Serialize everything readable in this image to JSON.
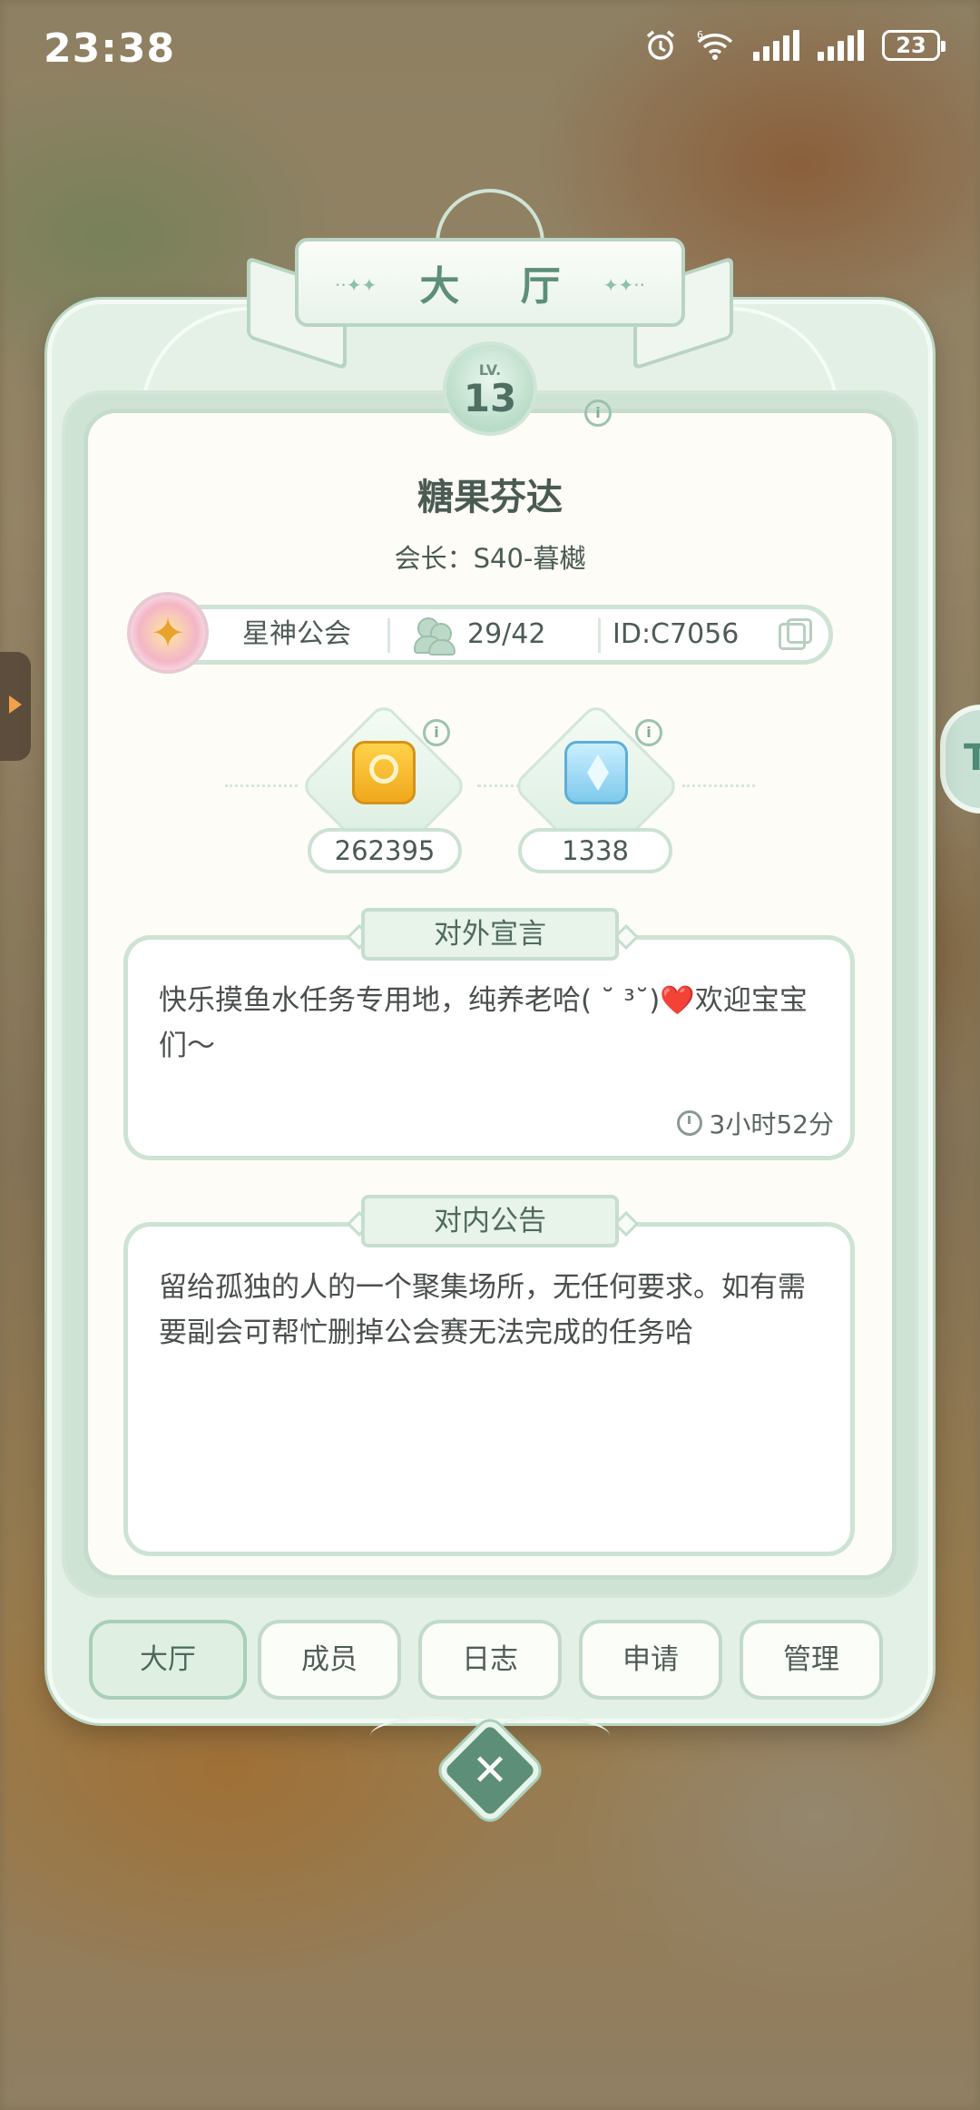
{
  "status_bar": {
    "time": "23:38",
    "battery": "23",
    "network_badge": "6"
  },
  "title": "大 厅",
  "level": {
    "prefix": "LV.",
    "value": "13"
  },
  "guild": {
    "name": "糖果芬达",
    "leader": "会长：S40-暮樾",
    "type": "星神公会",
    "members": "29/42",
    "id": "ID:C7056"
  },
  "currencies": [
    {
      "icon": "coin-icon",
      "value": "262395"
    },
    {
      "icon": "crystal-icon",
      "value": "1338"
    }
  ],
  "external_declaration": {
    "title": "对外宣言",
    "text": "快乐摸鱼水任务专用地，纯养老哈( ˘ ³˘)❤️欢迎宝宝们～",
    "time": "3小时52分"
  },
  "internal_notice": {
    "title": "对内公告",
    "text": "留给孤独的人的一个聚集场所，无任何要求。如有需要副会可帮忙删掉公会赛无法完成的任务哈"
  },
  "tabs": [
    {
      "label": "大厅",
      "active": true
    },
    {
      "label": "成员",
      "active": false
    },
    {
      "label": "日志",
      "active": false
    },
    {
      "label": "申请",
      "active": false
    },
    {
      "label": "管理",
      "active": false
    }
  ],
  "side_tab_right": "T",
  "colors": {
    "accent": "#5d8f78",
    "panel": "#e3f0e6",
    "border": "#c5dccc"
  }
}
